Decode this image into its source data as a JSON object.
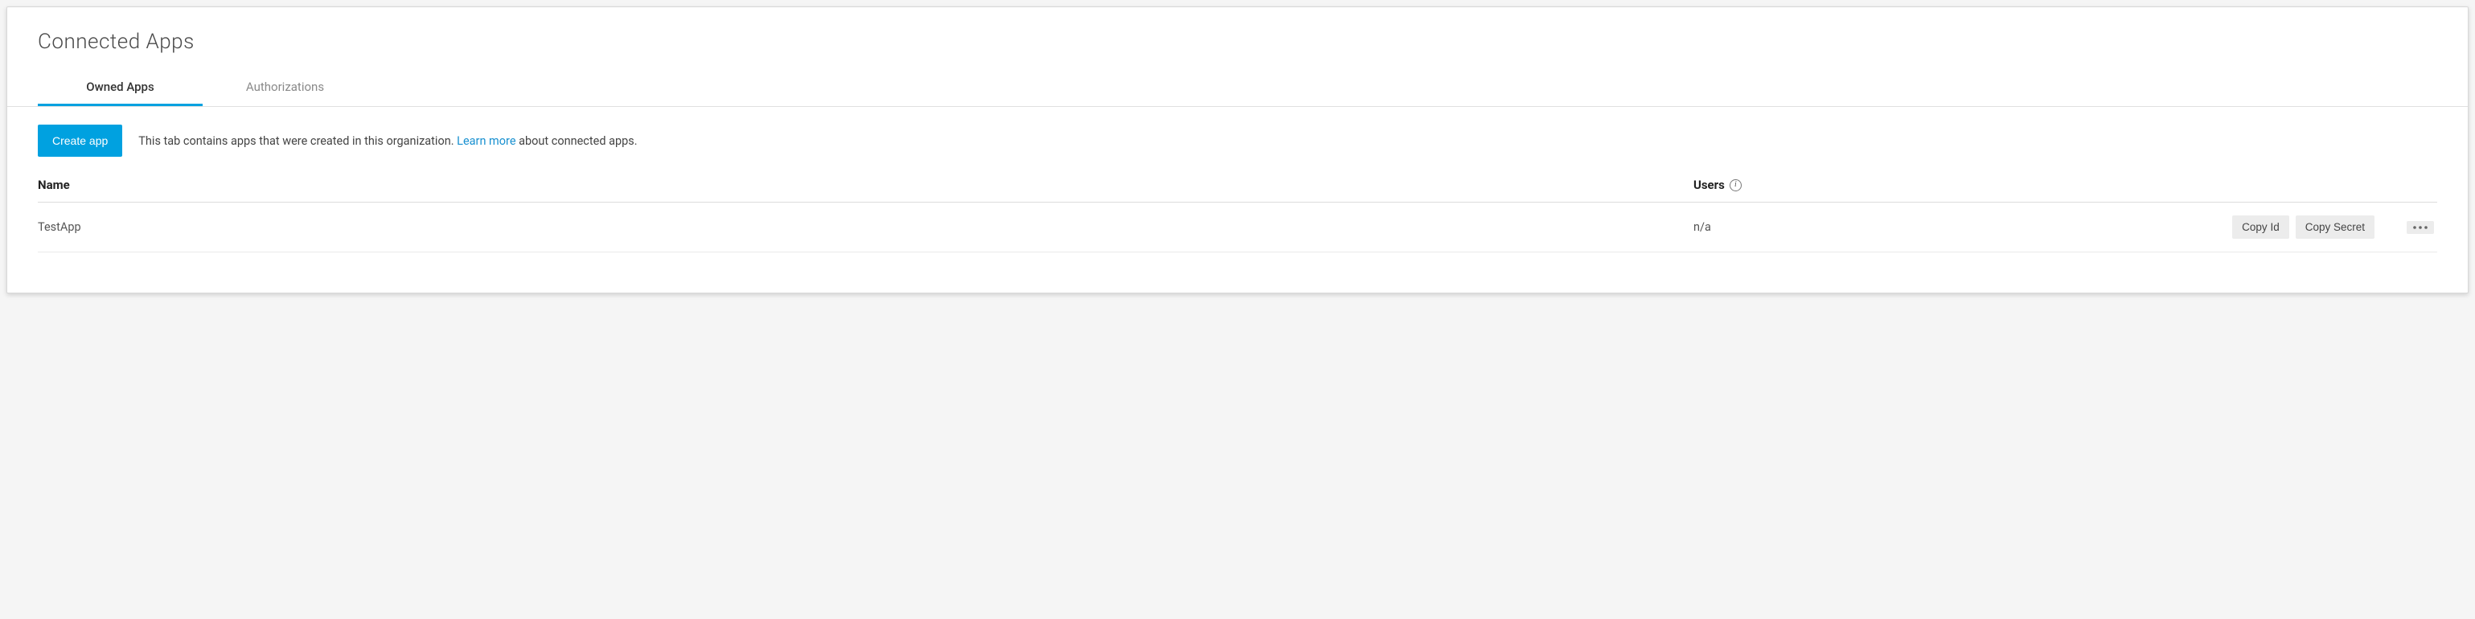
{
  "header": {
    "title": "Connected Apps"
  },
  "tabs": [
    {
      "label": "Owned Apps",
      "active": true
    },
    {
      "label": "Authorizations",
      "active": false
    }
  ],
  "toolbar": {
    "create_label": "Create app",
    "desc_prefix": "This tab contains apps that were created in this organization. ",
    "learn_more_label": "Learn more",
    "desc_suffix": " about connected apps."
  },
  "table": {
    "columns": {
      "name": "Name",
      "users": "Users"
    },
    "rows": [
      {
        "name": "TestApp",
        "users": "n/a",
        "copy_id_label": "Copy Id",
        "copy_secret_label": "Copy Secret"
      }
    ]
  },
  "icons": {
    "info": "info-icon",
    "more": "more-icon"
  }
}
